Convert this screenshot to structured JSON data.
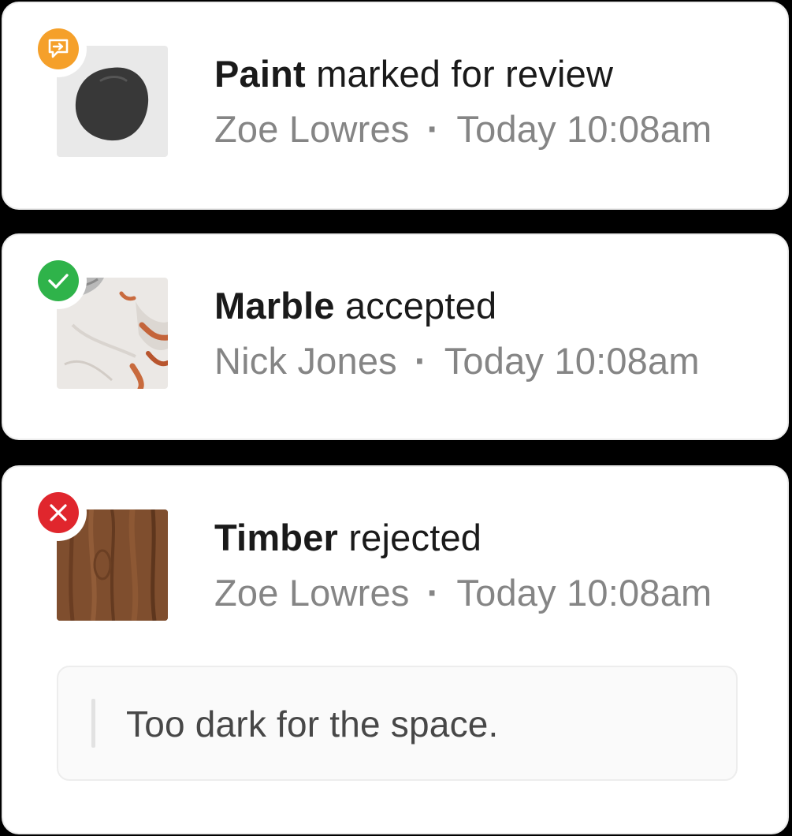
{
  "colors": {
    "review": "#f5a02a",
    "accepted": "#2fb34a",
    "rejected": "#e0262d",
    "title_text": "#1a1a1a",
    "meta_text": "#858585"
  },
  "activities": [
    {
      "material": "Paint",
      "action": "marked for review",
      "user": "Zoe Lowres",
      "separator": "·",
      "time": "Today 10:08am",
      "status": "review",
      "status_icon": "review-chat-icon",
      "thumbnail": "paint-swatch"
    },
    {
      "material": "Marble",
      "action": "accepted",
      "user": "Nick Jones",
      "separator": "·",
      "time": "Today 10:08am",
      "status": "accepted",
      "status_icon": "check-icon",
      "thumbnail": "marble-swatch"
    },
    {
      "material": "Timber",
      "action": "rejected",
      "user": "Zoe Lowres",
      "separator": "·",
      "time": "Today 10:08am",
      "status": "rejected",
      "status_icon": "close-icon",
      "thumbnail": "timber-swatch",
      "comment": "Too dark for the space."
    }
  ]
}
